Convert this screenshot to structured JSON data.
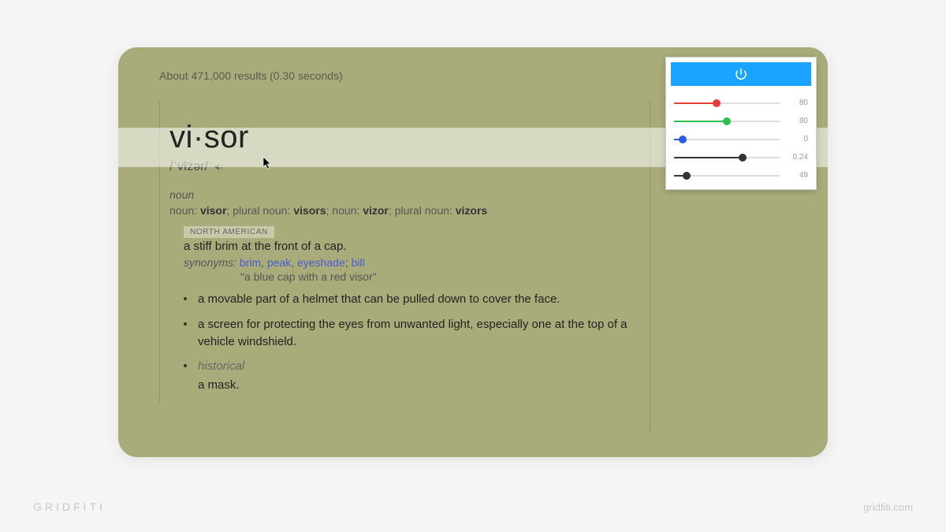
{
  "results_count": "About 471,000 results (0.30 seconds)",
  "word": "vi·sor",
  "pronunciation": "/ˈvīzər/",
  "part_of_speech": "noun",
  "forms_l1": "noun: ",
  "forms_b1": "visor",
  "forms_l2": "; plural noun: ",
  "forms_b2": "visors",
  "forms_l3": "; noun: ",
  "forms_b3": "vizor",
  "forms_l4": "; plural noun: ",
  "forms_b4": "vizors",
  "region_tag": "NORTH AMERICAN",
  "definition1": "a stiff brim at the front of a cap.",
  "syn_label": "synonyms:",
  "synonyms": {
    "s1": "brim",
    "s2": "peak",
    "s3": "eyeshade",
    "s4": "bill"
  },
  "example": "\"a blue cap with a red visor\"",
  "bullets": {
    "b1": "a movable part of a helmet that can be pulled down to cover the face.",
    "b2": "a screen for protecting the eyes from unwanted light, especially one at the top of a vehicle windshield.",
    "b3_label": "historical",
    "b3": "a mask."
  },
  "panel": {
    "sliders": {
      "red": {
        "value": "80",
        "percent": 40,
        "color": "#e63c3c"
      },
      "green": {
        "value": "80",
        "percent": 50,
        "color": "#2bbf4a"
      },
      "blue": {
        "value": "0",
        "percent": 8,
        "color": "#2b5bdf"
      },
      "alpha": {
        "value": "0.24",
        "percent": 65,
        "color": "#333"
      },
      "other": {
        "value": "49",
        "percent": 12,
        "color": "#333"
      }
    }
  },
  "footer": {
    "brand": "GRIDFITI",
    "url": "gridfiti.com"
  }
}
